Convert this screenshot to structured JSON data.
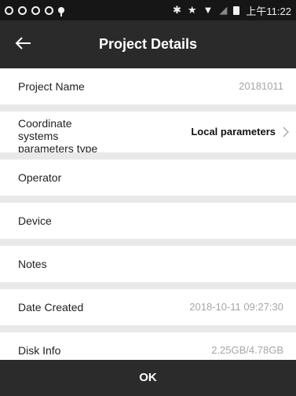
{
  "status_bar": {
    "time": "上午11:22"
  },
  "app_bar": {
    "title": "Project Details"
  },
  "fields": [
    {
      "label": "Project Name",
      "value": "20181011"
    },
    {
      "label": "Coordinate systems parameters type",
      "value": "Local parameters"
    },
    {
      "label": "Operator",
      "value": ""
    },
    {
      "label": "Device",
      "value": ""
    },
    {
      "label": "Notes",
      "value": ""
    },
    {
      "label": "Date Created",
      "value": "2018-10-11 09:27:30"
    },
    {
      "label": "Disk Info",
      "value": "2.25GB/4.78GB"
    }
  ],
  "footer": {
    "ok_label": "OK"
  }
}
